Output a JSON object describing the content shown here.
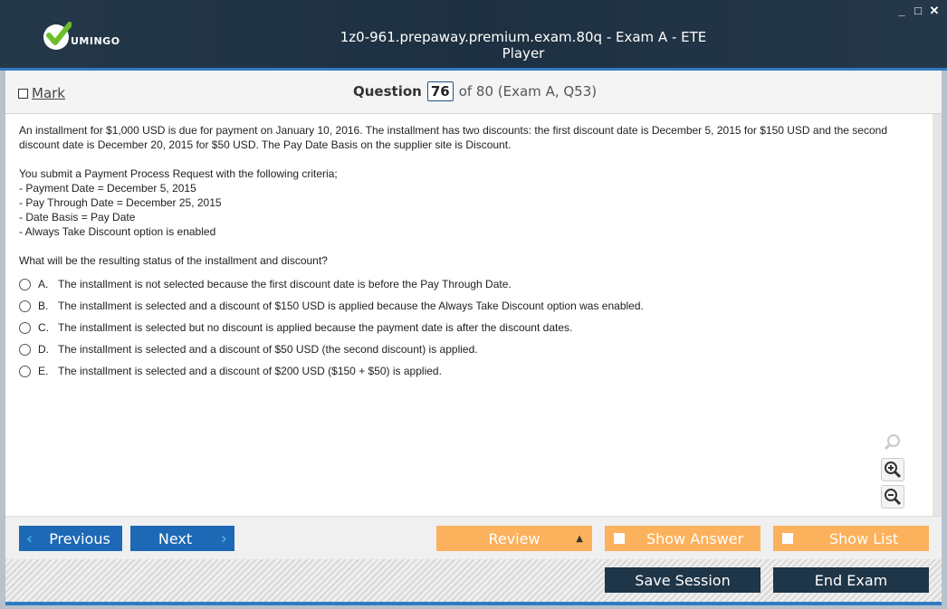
{
  "window": {
    "logo_text": "UMINGO",
    "title": "1z0-961.prepaway.premium.exam.80q - Exam A - ETE Player",
    "controls": {
      "minimize": "_",
      "maximize": "□",
      "close": "✕"
    }
  },
  "header": {
    "mark_label": "Mark",
    "question_label": "Question",
    "question_number": "76",
    "question_of": "of 80 (Exam A, Q53)"
  },
  "question": {
    "paragraph1": "An installment for $1,000 USD is due for payment on January 10, 2016. The installment has two discounts: the first discount date is December 5, 2015 for $150 USD and the second discount date is December 20, 2015 for $50 USD. The Pay Date Basis on the supplier site is Discount.",
    "paragraph2_intro": "You submit a Payment Process Request with the following criteria;",
    "criteria": [
      "- Payment Date = December 5, 2015",
      "- Pay Through Date = December 25, 2015",
      "- Date Basis = Pay Date",
      "- Always Take Discount option is enabled"
    ],
    "prompt": "What will be the resulting status of the installment and discount?",
    "options": [
      {
        "letter": "A.",
        "text": "The installment is not selected because the first discount date is before the Pay Through Date."
      },
      {
        "letter": "B.",
        "text": "The installment is selected and a discount of $150 USD is applied because the Always Take Discount option was enabled."
      },
      {
        "letter": "C.",
        "text": "The installment is selected but no discount is applied because the payment date is after the discount dates."
      },
      {
        "letter": "D.",
        "text": "The installment is selected and a discount of $50 USD (the second discount) is applied."
      },
      {
        "letter": "E.",
        "text": "The installment is selected and a discount of $200 USD ($150 + $50) is applied."
      }
    ]
  },
  "icons": [
    "check-logo-icon",
    "search-icon",
    "zoom-in-icon",
    "zoom-out-icon",
    "chevron-left-icon",
    "chevron-right-icon",
    "triangle-up-icon"
  ],
  "nav": {
    "previous": "Previous",
    "next": "Next",
    "review": "Review",
    "show_answer": "Show Answer",
    "show_list": "Show List",
    "save_session": "Save Session",
    "end_exam": "End Exam"
  },
  "colors": {
    "title_bg": "#1d3041",
    "accent_blue": "#1e69b6",
    "orange": "#fcb15c",
    "dark_button": "#1f3548",
    "logo_green": "#6cbf2a"
  }
}
